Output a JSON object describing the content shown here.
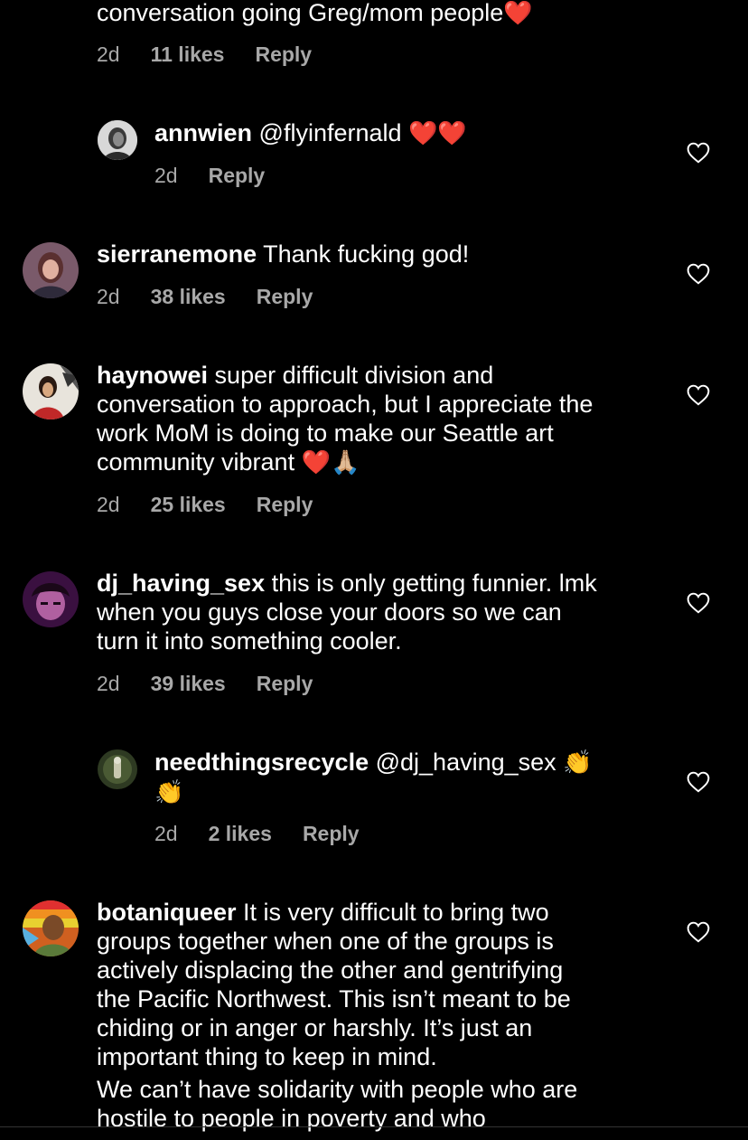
{
  "comments": [
    {
      "text_tail": "conversation going Greg/mom people",
      "emoji": "❤️",
      "time": "2d",
      "likes": "11 likes",
      "reply": "Reply"
    },
    {
      "username": "annwien",
      "mention": "@flyinfernald",
      "emoji": "❤️❤️",
      "time": "2d",
      "reply": "Reply"
    },
    {
      "username": "sierranemone",
      "text": "Thank fucking god!",
      "time": "2d",
      "likes": "38 likes",
      "reply": "Reply"
    },
    {
      "username": "haynowei",
      "text_lines": [
        "super difficult division and",
        "conversation to approach, but I appreciate the",
        "work MoM is doing to make our Seattle art",
        "community vibrant"
      ],
      "emoji": "❤️🙏🏼",
      "time": "2d",
      "likes": "25 likes",
      "reply": "Reply"
    },
    {
      "username": "dj_having_sex",
      "text_lines": [
        "this is only getting funnier. lmk",
        "when you guys close your doors so we can",
        "turn it into something cooler."
      ],
      "time": "2d",
      "likes": "39 likes",
      "reply": "Reply"
    },
    {
      "username": "needthingsrecycle",
      "mention": "@dj_having_sex",
      "emoji1": "👏",
      "emoji2": "👏",
      "time": "2d",
      "likes": "2 likes",
      "reply": "Reply"
    },
    {
      "username": "botaniqueer",
      "text_lines": [
        "It is very difficult to bring two",
        "groups together when one of the groups is",
        "actively displacing the other and gentrifying",
        "the Pacific Northwest. This isn’t meant to be",
        "chiding or in anger or harshly. It’s just an",
        "important thing to keep in mind.",
        "We can’t have solidarity with people who are",
        "hostile to people in poverty and who"
      ]
    }
  ],
  "icons": {
    "like": "heart-outline-icon"
  },
  "colors": {
    "background": "#000000",
    "text": "#ffffff",
    "meta": "#a8a8a8"
  }
}
